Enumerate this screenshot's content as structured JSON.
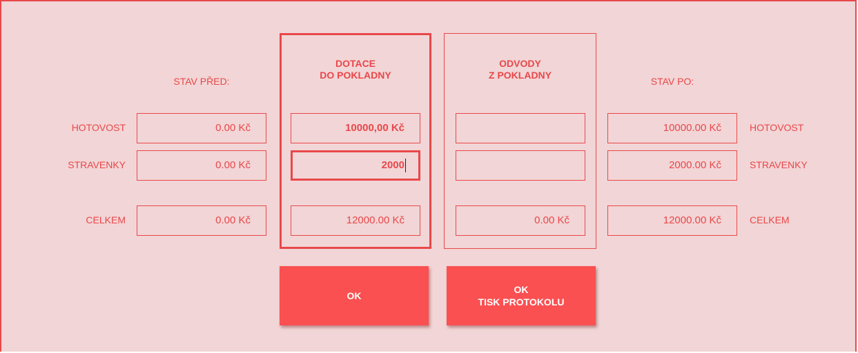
{
  "colors": {
    "accent": "#e8474a",
    "background": "#f2d5d6",
    "button": "#fa5051",
    "button_text": "#ffffff"
  },
  "headers": {
    "stav_pred": "STAV PŘED:",
    "dotace_line1": "DOTACE",
    "dotace_line2": "DO POKLADNY",
    "odvody_line1": "ODVODY",
    "odvody_line2": "Z POKLADNY",
    "stav_po": "STAV PO:"
  },
  "row_labels_left": {
    "hotovost": "HOTOVOST",
    "stravenky": "STRAVENKY",
    "celkem": "CELKEM"
  },
  "row_labels_right": {
    "hotovost": "HOTOVOST",
    "stravenky": "STRAVENKY",
    "celkem": "CELKEM"
  },
  "stav_pred": {
    "hotovost": "0.00 Kč",
    "stravenky": "0.00 Kč",
    "celkem": "0.00 Kč"
  },
  "dotace": {
    "hotovost": "10000,00 Kč",
    "stravenky": "2000",
    "celkem": "12000.00 Kč"
  },
  "odvody": {
    "hotovost": "",
    "stravenky": "",
    "celkem": "0.00 Kč"
  },
  "stav_po": {
    "hotovost": "10000.00 Kč",
    "stravenky": "2000.00 Kč",
    "celkem": "12000.00 Kč"
  },
  "buttons": {
    "ok": "OK",
    "ok_print_line1": "OK",
    "ok_print_line2": "TISK PROTOKOLU"
  }
}
